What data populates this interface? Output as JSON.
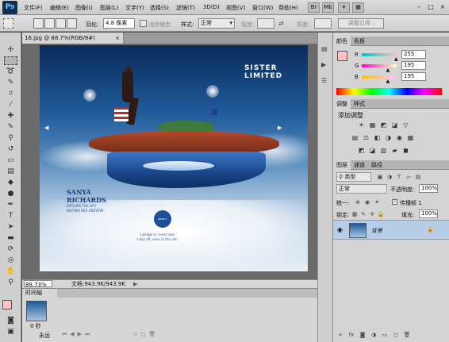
{
  "app": {
    "logo": "Ps",
    "menus": [
      "文件(F)",
      "编辑(E)",
      "图像(I)",
      "图层(L)",
      "文字(Y)",
      "选择(S)",
      "滤镜(T)",
      "3D(D)",
      "视图(V)",
      "窗口(W)",
      "帮助(H)"
    ],
    "window_controls": [
      "–",
      "□",
      "×"
    ]
  },
  "options": {
    "feather_label": "羽化:",
    "feather_value": "4.8 像素",
    "antialias_label": "消除锯齿",
    "style_label": "样式:",
    "style_value": "正常",
    "width_label": "宽度:",
    "height_label": "高度:",
    "refine_edge": "调整边缘..."
  },
  "document": {
    "tab_title": "16.jpg @ 88.7%(RGB/8#)",
    "tab_close": "×",
    "zoom": "88.73%",
    "doc_size": "文档:943.9K/943.9K",
    "artwork": {
      "brand": "SISTER LIMITED",
      "name_line1": "SANYA",
      "name_line2": "RICHARDS",
      "tagline1": "EXPLORE THE LIFE",
      "tagline2": "BEYOND HER UNIFORM.",
      "pledge1": "I pledge to never take",
      "pledge2": "a day off, even in the rain.",
      "badge": "MADE A PLEDGE"
    }
  },
  "timeline": {
    "tab": "时间轴",
    "frame_duration": "0 秒",
    "loop": "永远"
  },
  "color_panel": {
    "tabs": [
      "颜色",
      "色板"
    ],
    "channels": [
      {
        "label": "R",
        "value": "255",
        "thumb": 1.0
      },
      {
        "label": "G",
        "value": "195",
        "thumb": 0.765
      },
      {
        "label": "B",
        "value": "195",
        "thumb": 0.765
      }
    ],
    "fg_color": "#ffc3c3"
  },
  "adjust_panel": {
    "tabs": [
      "调整",
      "样式"
    ],
    "title": "添加调整",
    "row1": [
      "☀",
      "▦",
      "◩",
      "◪",
      "▽"
    ],
    "row2": [
      "▤",
      "⚖",
      "◧",
      "◑",
      "◉",
      "▦"
    ],
    "row3": [
      "◩",
      "◪",
      "▥",
      "▰",
      "◼"
    ]
  },
  "layers_panel": {
    "tabs": [
      "图层",
      "通道",
      "路径"
    ],
    "filter": "类型",
    "blend_mode": "正常",
    "opacity_label": "不透明度:",
    "opacity_value": "100%",
    "unify_label": "统一:",
    "propagate_label": "传播帧 1",
    "lock_label": "锁定:",
    "fill_label": "填充:",
    "fill_value": "100%",
    "layer_name": "背景",
    "lock_icon": "🔒"
  }
}
